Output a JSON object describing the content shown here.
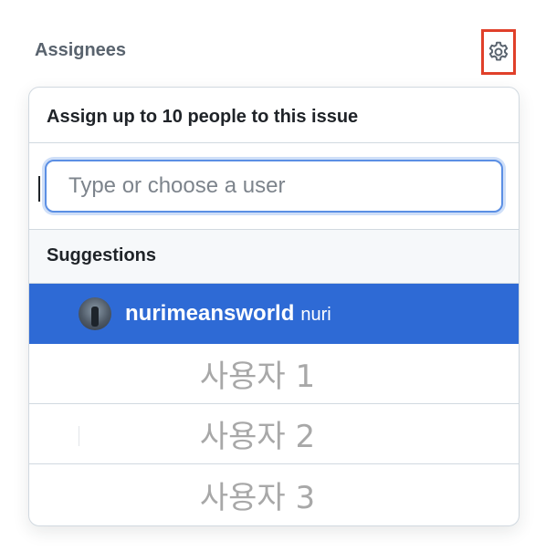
{
  "sidebar": {
    "assignees_label": "Assignees",
    "settings_icon": "gear-icon"
  },
  "popover": {
    "title": "Assign up to 10 people to this issue",
    "filter": {
      "placeholder": "Type or choose a user",
      "value": ""
    },
    "suggestions_label": "Suggestions",
    "users": [
      {
        "login": "nurimeansworld",
        "name": "nuri",
        "selected": true,
        "avatar_icon": "user-avatar"
      }
    ],
    "placeholder_rows": [
      {
        "label": "사용자 1"
      },
      {
        "label": "사용자 2"
      },
      {
        "label": "사용자 3"
      }
    ]
  },
  "colors": {
    "highlight": "#2e6ad5",
    "focus_ring": "#5b8fe4",
    "annotation_box": "#e0402a"
  }
}
